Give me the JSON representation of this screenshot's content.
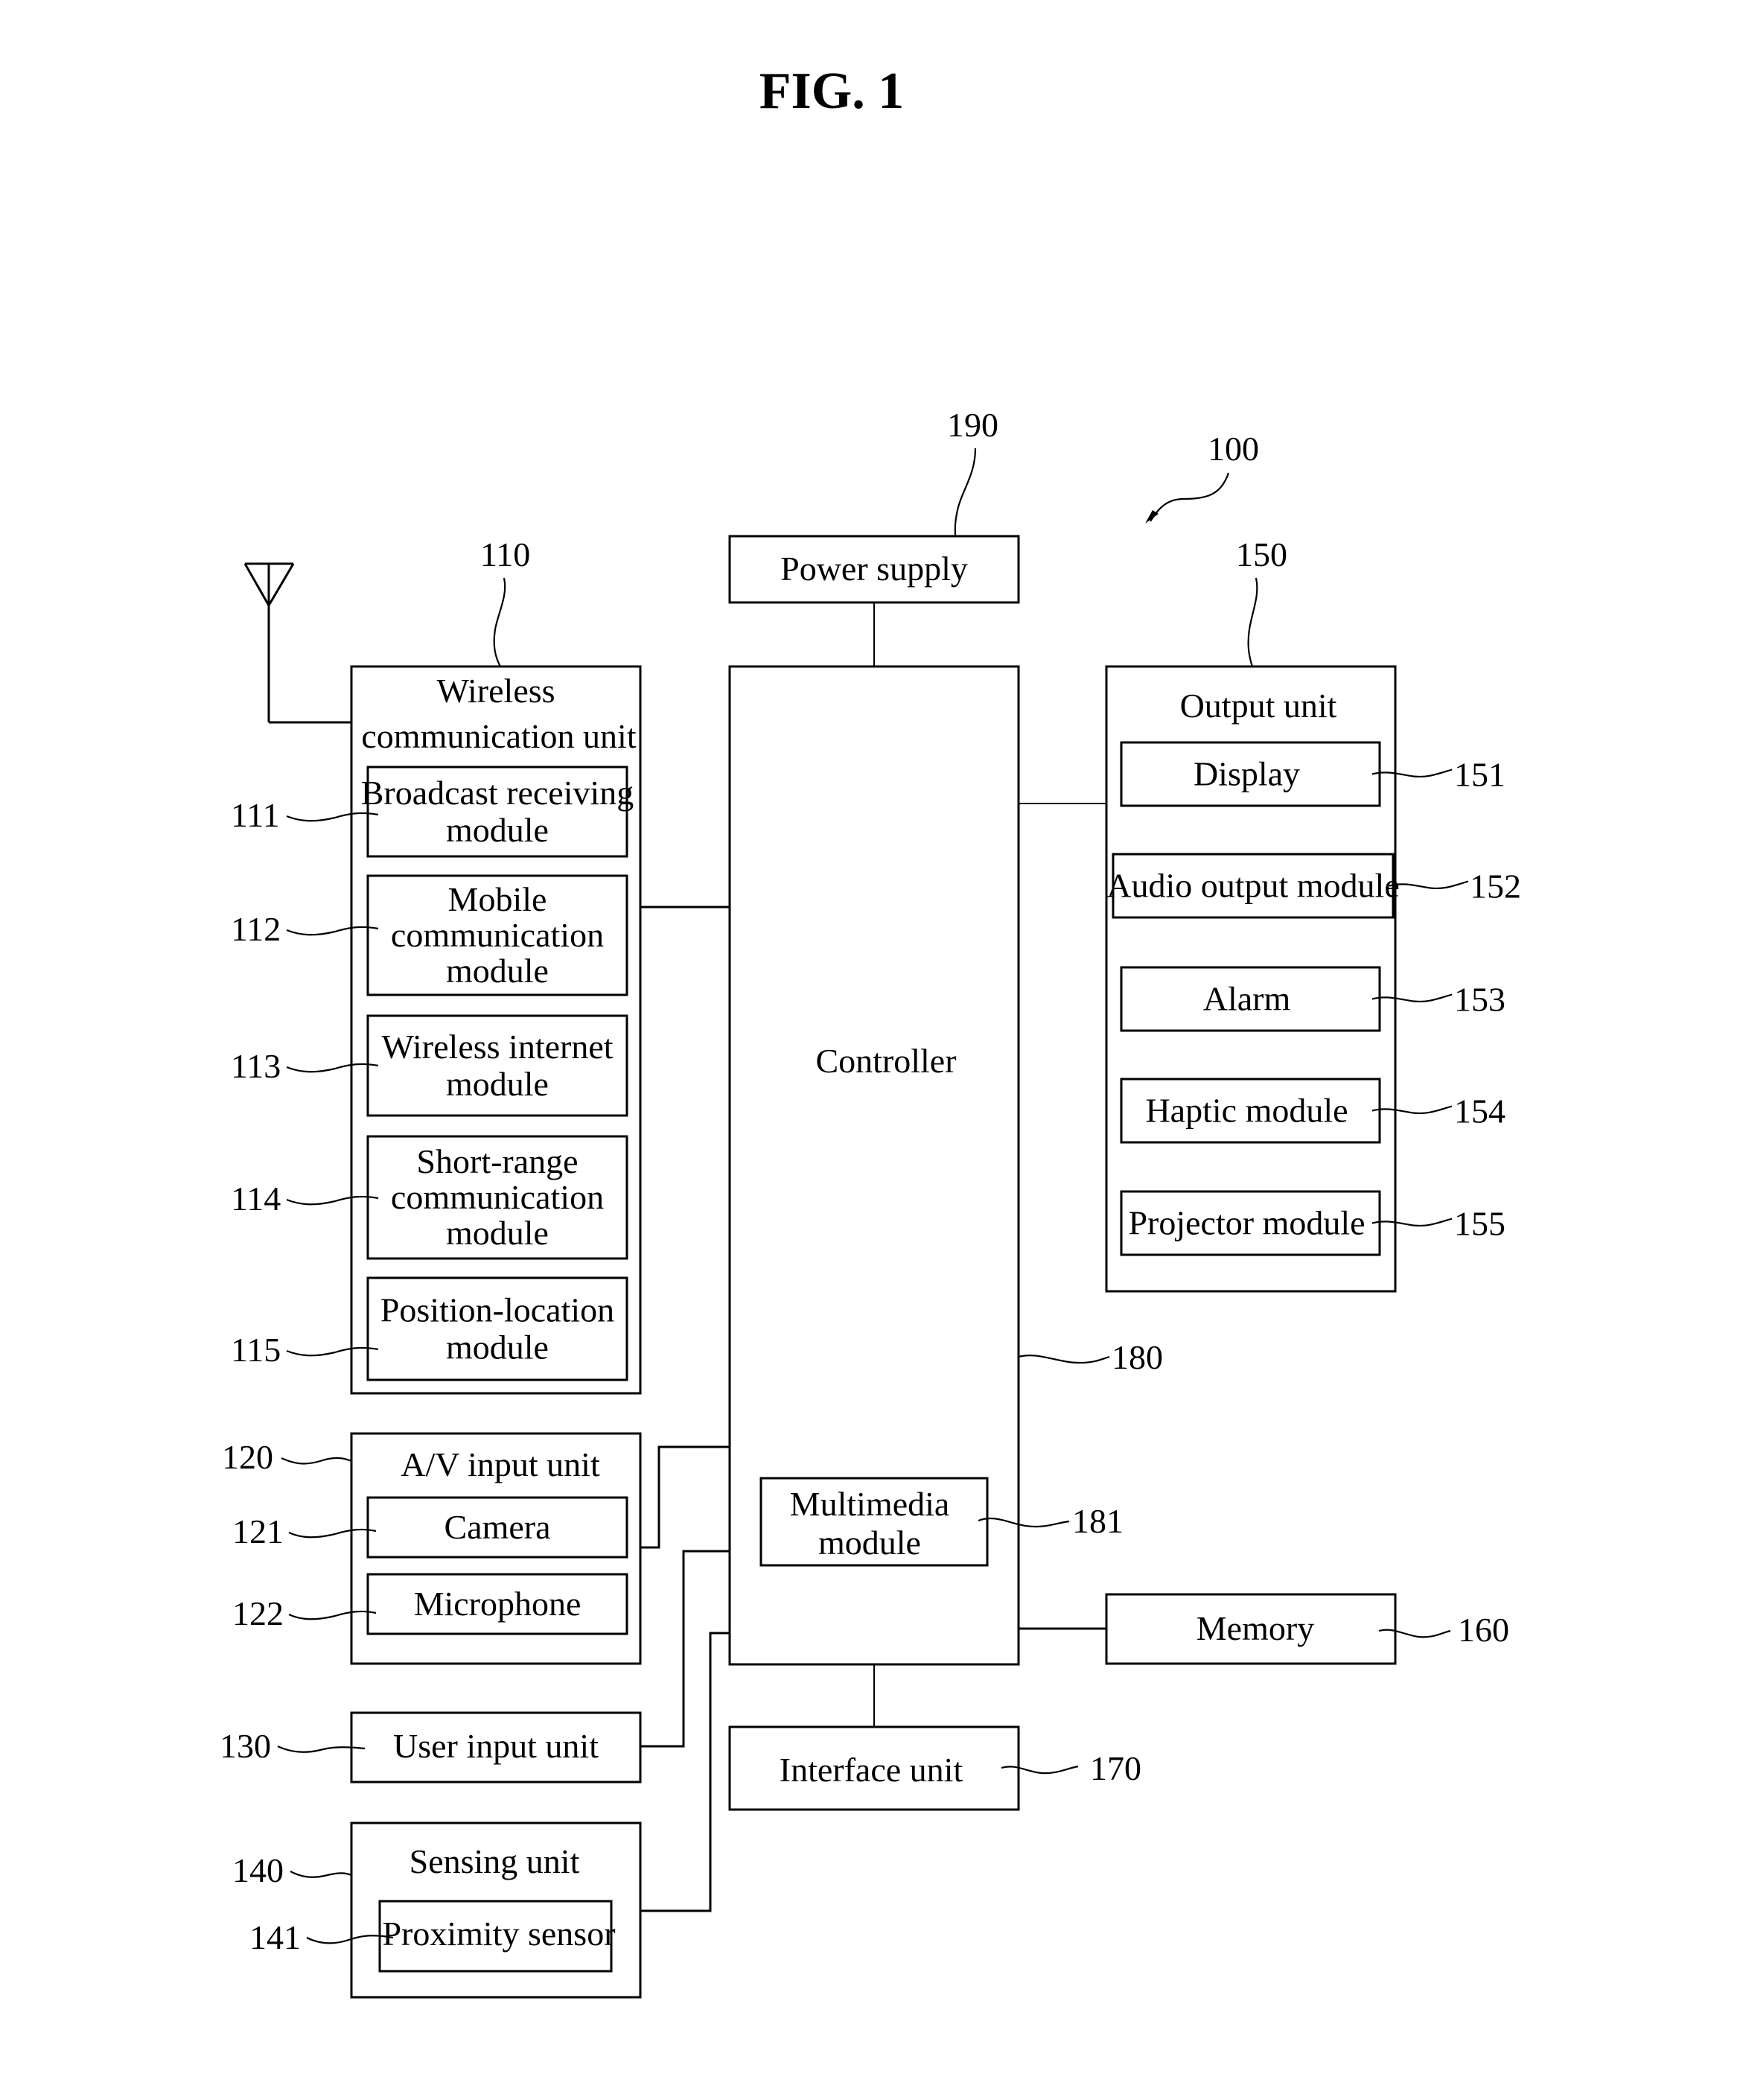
{
  "figure": {
    "title": "FIG. 1",
    "device_ref": "100"
  },
  "power_supply": {
    "ref": "190",
    "label": "Power supply"
  },
  "controller": {
    "ref": "180",
    "label": "Controller",
    "multimedia": {
      "ref": "181",
      "label_lines": [
        "Multimedia",
        "module"
      ]
    }
  },
  "wireless_unit": {
    "ref": "110",
    "label_lines": [
      "Wireless",
      "communication unit"
    ],
    "antenna_icon": "antenna-icon",
    "modules": [
      {
        "ref": "111",
        "label_lines": [
          "Broadcast receiving",
          "module"
        ]
      },
      {
        "ref": "112",
        "label_lines": [
          "Mobile",
          "communication",
          "module"
        ]
      },
      {
        "ref": "113",
        "label_lines": [
          "Wireless internet",
          "module"
        ]
      },
      {
        "ref": "114",
        "label_lines": [
          "Short-range",
          "communication",
          "module"
        ]
      },
      {
        "ref": "115",
        "label_lines": [
          "Position-location",
          "module"
        ]
      }
    ]
  },
  "av_input_unit": {
    "ref": "120",
    "label": "A/V input unit",
    "modules": [
      {
        "ref": "121",
        "label": "Camera"
      },
      {
        "ref": "122",
        "label": "Microphone"
      }
    ]
  },
  "user_input_unit": {
    "ref": "130",
    "label": "User input unit"
  },
  "sensing_unit": {
    "ref": "140",
    "label": "Sensing unit",
    "modules": [
      {
        "ref": "141",
        "label": "Proximity sensor"
      }
    ]
  },
  "output_unit": {
    "ref": "150",
    "label": "Output unit",
    "modules": [
      {
        "ref": "151",
        "label": "Display"
      },
      {
        "ref": "152",
        "label": "Audio output module"
      },
      {
        "ref": "153",
        "label": "Alarm"
      },
      {
        "ref": "154",
        "label": "Haptic module"
      },
      {
        "ref": "155",
        "label": "Projector module"
      }
    ]
  },
  "memory": {
    "ref": "160",
    "label": "Memory"
  },
  "interface_unit": {
    "ref": "170",
    "label": "Interface unit"
  }
}
